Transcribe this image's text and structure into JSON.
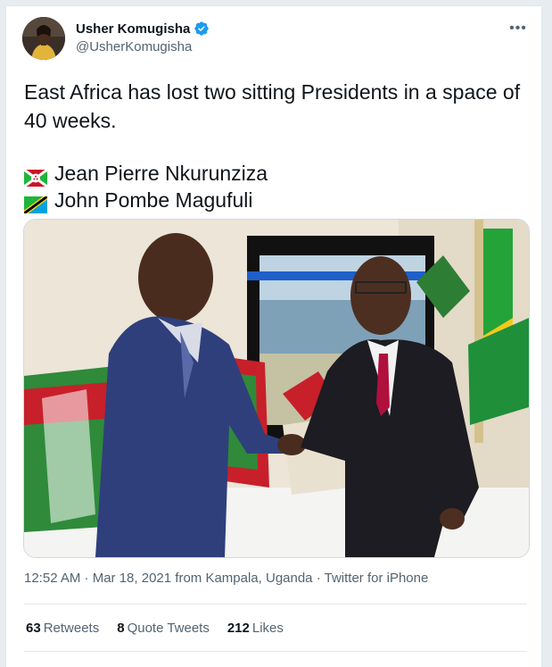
{
  "tweet": {
    "author": {
      "display_name": "Usher Komugisha",
      "handle": "@UsherKomugisha",
      "verified": true
    },
    "text_line1": "East Africa has lost two sitting Presidents in a space of",
    "text_line2": "40 weeks.",
    "flag_lines": [
      {
        "flag": "burundi-flag-icon",
        "text": "Jean Pierre Nkurunziza"
      },
      {
        "flag": "tanzania-flag-icon",
        "text": "John Pombe Magufuli"
      }
    ],
    "timestamp": "12:52 AM · Mar 18, 2021",
    "location": "from Kampala, Uganda",
    "source": "Twitter for iPhone",
    "stats": {
      "retweets_count": "63",
      "retweets_label": "Retweets",
      "quotes_count": "8",
      "quotes_label": "Quote Tweets",
      "likes_count": "212",
      "likes_label": "Likes"
    }
  },
  "icons": {
    "verified": "verified-badge-icon",
    "more": "more-options-icon"
  },
  "colors": {
    "accent_blue": "#1d9bf0",
    "secondary_text": "#536471",
    "primary_text": "#0f1419",
    "divider": "#e1e8ed"
  }
}
